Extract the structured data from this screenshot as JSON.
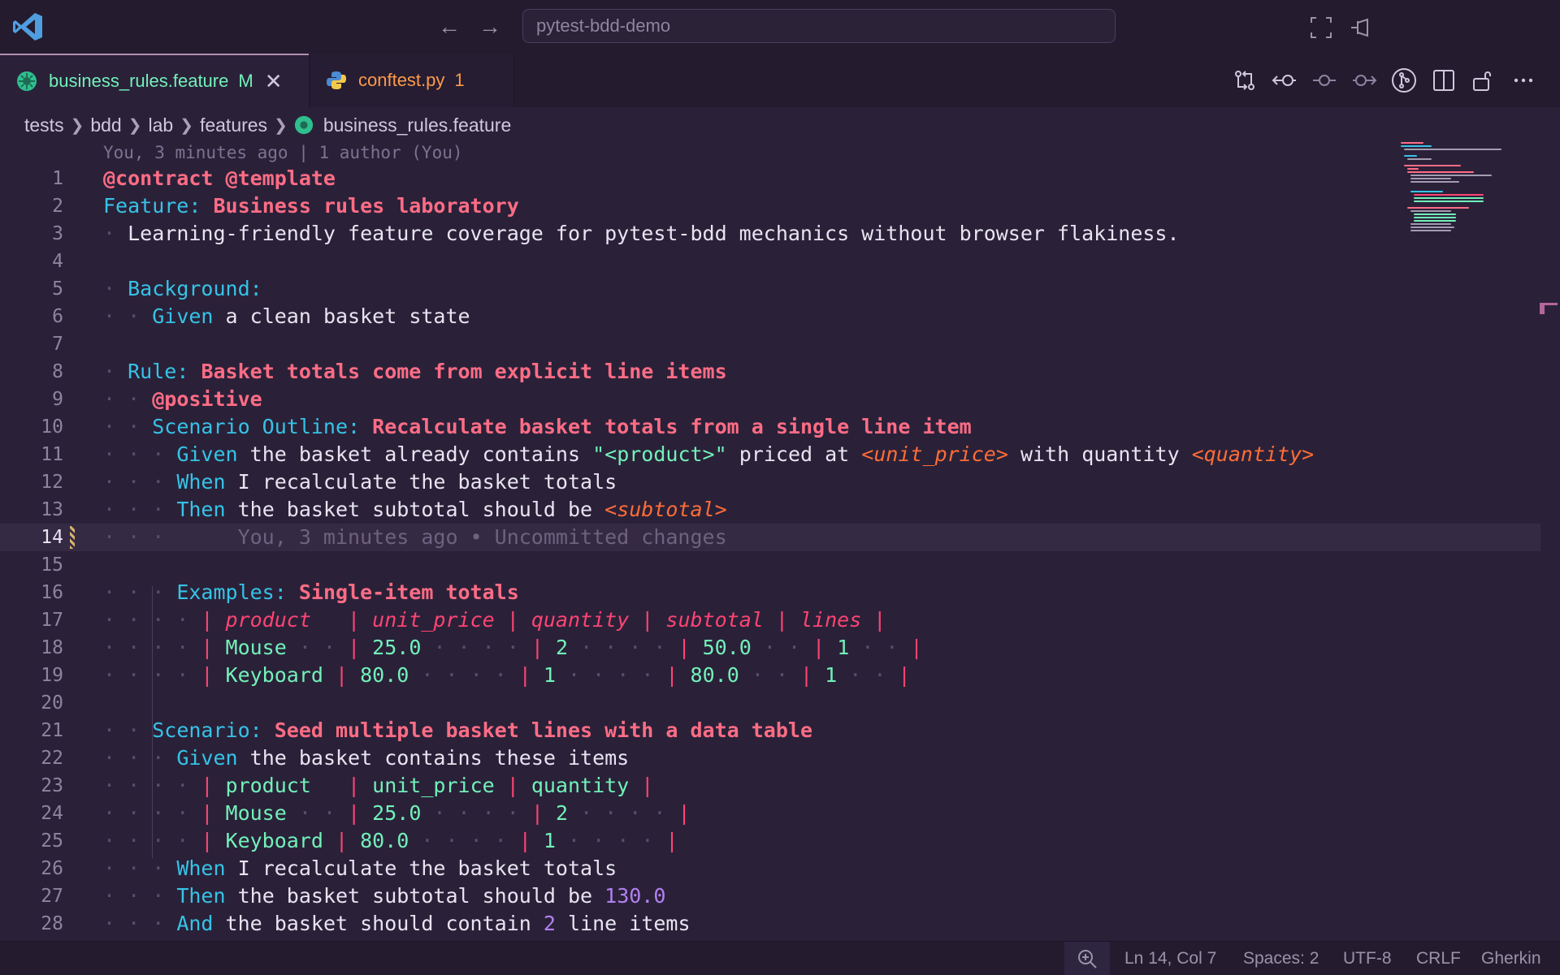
{
  "titlebar": {
    "search_text": "pytest-bdd-demo"
  },
  "tabs": [
    {
      "label": "business_rules.feature",
      "badge": "M",
      "icon": "gherkin-icon",
      "state": "active"
    },
    {
      "label": "conftest.py",
      "badge": "1",
      "icon": "python-icon",
      "state": "inactive"
    }
  ],
  "breadcrumb": [
    "tests",
    "bdd",
    "lab",
    "features",
    "business_rules.feature"
  ],
  "editor": {
    "blame_header": "You, 3 minutes ago | 1 author (You)",
    "current_line_blame": "You, 3 minutes ago • Uncommitted changes",
    "line_numbers": [
      "1",
      "2",
      "3",
      "4",
      "5",
      "6",
      "7",
      "8",
      "9",
      "10",
      "11",
      "12",
      "13",
      "14",
      "15",
      "16",
      "17",
      "18",
      "19",
      "20",
      "21",
      "22",
      "23",
      "24",
      "25",
      "26",
      "27",
      "28"
    ],
    "current_line": 14,
    "tokens": {
      "l1_tags": "@contract @template",
      "l2_kw": "Feature:",
      "l2_title": "Business rules laboratory",
      "l3_text": "Learning-friendly feature coverage for pytest-bdd mechanics without browser flakiness.",
      "l5_kw": "Background:",
      "l6_kw": "Given",
      "l6_text": "a clean basket state",
      "l8_kw": "Rule:",
      "l8_title": "Basket totals come from explicit line items",
      "l9_tag": "@positive",
      "l10_kw": "Scenario Outline:",
      "l10_title": "Recalculate basket totals from a single line item",
      "l11_kw": "Given",
      "l11_t1": "the basket already contains",
      "l11_str": "\"<product>\"",
      "l11_t2": "priced at",
      "l11_p1": "<unit_price>",
      "l11_t3": "with quantity",
      "l11_p2": "<quantity>",
      "l12_kw": "When",
      "l12_text": "I recalculate the basket totals",
      "l13_kw": "Then",
      "l13_text": "the basket subtotal should be",
      "l13_p": "<subtotal>",
      "l16_kw": "Examples:",
      "l16_title": "Single-item totals",
      "l21_kw": "Scenario:",
      "l21_title": "Seed multiple basket lines with a data table",
      "l22_kw": "Given",
      "l22_text": "the basket contains these items",
      "l26_kw": "When",
      "l26_text": "I recalculate the basket totals",
      "l27_kw": "Then",
      "l27_text": "the basket subtotal should be",
      "l27_num": "130.0",
      "l28_kw": "And",
      "l28_t1": "the basket should contain",
      "l28_num": "2",
      "l28_t2": "line items"
    },
    "examples_table": {
      "header": [
        "product",
        "unit_price",
        "quantity",
        "subtotal",
        "lines"
      ],
      "rows": [
        [
          "Mouse",
          "25.0",
          "2",
          "50.0",
          "1"
        ],
        [
          "Keyboard",
          "80.0",
          "1",
          "80.0",
          "1"
        ]
      ]
    },
    "data_table": {
      "header": [
        "product",
        "unit_price",
        "quantity"
      ],
      "rows": [
        [
          "Mouse",
          "25.0",
          "2"
        ],
        [
          "Keyboard",
          "80.0",
          "1"
        ]
      ]
    }
  },
  "statusbar": {
    "position": "Ln 14, Col 7",
    "spaces": "Spaces: 2",
    "encoding": "UTF-8",
    "eol": "CRLF",
    "language": "Gherkin"
  },
  "colors": {
    "background": "#2a2139",
    "keyword": "#36c3e6",
    "title": "#fe6d85",
    "string": "#72f1b8",
    "parameter": "#fe6d36",
    "number": "#b280f0",
    "active_tab_text": "#72f1b8",
    "inactive_tab_text": "#fe9a4a"
  }
}
